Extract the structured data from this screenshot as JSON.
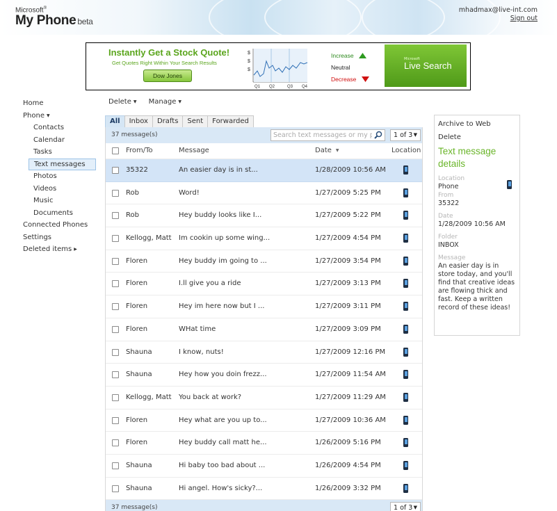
{
  "header": {
    "brand_small": "Microsoft",
    "brand_mark": "®",
    "brand_title": "My Phone",
    "brand_tag": "beta",
    "user_email": "mhadmax@live-int.com",
    "sign_out": "Sign out"
  },
  "ad": {
    "title": "Instantly Get a Stock Quote!",
    "subtitle": "Get Quotes Right Within Your Search Results",
    "button": "Dow Jones",
    "chart_ticks_x": [
      "Q1",
      "Q2",
      "Q3",
      "Q4"
    ],
    "chart_tick_y": "$",
    "increase": "Increase",
    "neutral": "Neutral",
    "decrease": "Decrease",
    "live_small": "Microsoft",
    "live_search": "Live Search",
    "colors": {
      "green": "#5aa51c",
      "increase": "#2e8a1f",
      "decrease": "#d01010"
    }
  },
  "nav": {
    "home": "Home",
    "phone": "Phone",
    "contacts": "Contacts",
    "calendar": "Calendar",
    "tasks": "Tasks",
    "text_messages": "Text messages",
    "photos": "Photos",
    "videos": "Videos",
    "music": "Music",
    "documents": "Documents",
    "connected_phones": "Connected Phones",
    "settings": "Settings",
    "deleted_items": "Deleted items"
  },
  "toolbar": {
    "delete": "Delete",
    "manage": "Manage"
  },
  "tabs": [
    "All",
    "Inbox",
    "Drafts",
    "Sent",
    "Forwarded"
  ],
  "list": {
    "count": "37 message(s)",
    "search_placeholder": "Search text messages or my phone",
    "pager": "1 of 3",
    "columns": {
      "from": "From/To",
      "message": "Message",
      "date": "Date",
      "location": "Location"
    },
    "rows": [
      {
        "from": "35322",
        "message": "An easier day is in st...",
        "date": "1/28/2009 10:56 AM"
      },
      {
        "from": "Rob",
        "message": "Word!",
        "date": "1/27/2009 5:25 PM"
      },
      {
        "from": "Rob",
        "message": "Hey buddy looks like I...",
        "date": "1/27/2009 5:22 PM"
      },
      {
        "from": "Kellogg, Matt",
        "message": "Im cookin up some wing...",
        "date": "1/27/2009 4:54 PM"
      },
      {
        "from": "Floren",
        "message": "Hey buddy im going to ...",
        "date": "1/27/2009 3:54 PM"
      },
      {
        "from": "Floren",
        "message": "I.ll give you a ride",
        "date": "1/27/2009 3:13 PM"
      },
      {
        "from": "Floren",
        "message": "Hey im here now but I ...",
        "date": "1/27/2009 3:11 PM"
      },
      {
        "from": "Floren",
        "message": "WHat time",
        "date": "1/27/2009 3:09 PM"
      },
      {
        "from": "Shauna",
        "message": "I know, nuts!",
        "date": "1/27/2009 12:16 PM"
      },
      {
        "from": "Shauna",
        "message": "Hey how you doin frezz...",
        "date": "1/27/2009 11:54 AM"
      },
      {
        "from": "Kellogg, Matt",
        "message": "You back at work?",
        "date": "1/27/2009 11:29 AM"
      },
      {
        "from": "Floren",
        "message": "Hey what are you up to...",
        "date": "1/27/2009 10:36 AM"
      },
      {
        "from": "Floren",
        "message": "Hey buddy call matt he...",
        "date": "1/26/2009 5:16 PM"
      },
      {
        "from": "Shauna",
        "message": "Hi baby too bad about ...",
        "date": "1/26/2009 4:54 PM"
      },
      {
        "from": "Shauna",
        "message": "Hi angel. How's sicky?...",
        "date": "1/26/2009 3:32 PM"
      }
    ],
    "footer_count": "37 message(s)",
    "footer_pager": "1 of 3"
  },
  "detail": {
    "archive": "Archive to Web",
    "delete": "Delete",
    "title": "Text message details",
    "location_label": "Location",
    "location_value": "Phone",
    "from_label": "From",
    "from_value": "35322",
    "date_label": "Date",
    "date_value": "1/28/2009 10:56 AM",
    "folder_label": "Folder",
    "folder_value": "INBOX",
    "message_label": "Message",
    "message_value": "An easier day is in store today, and you'll find that creative ideas are flowing thick and fast. Keep a written record of these ideas!"
  }
}
